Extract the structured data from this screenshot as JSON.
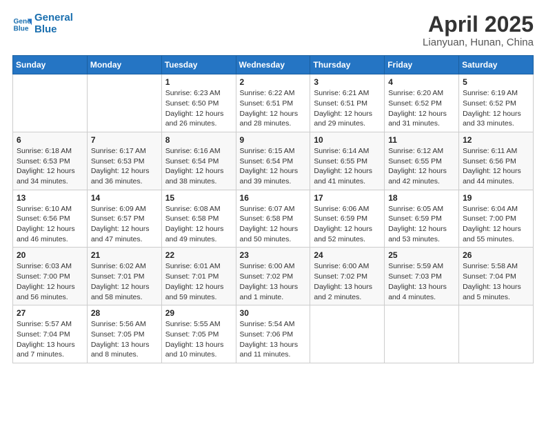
{
  "header": {
    "logo_line1": "General",
    "logo_line2": "Blue",
    "title": "April 2025",
    "subtitle": "Lianyuan, Hunan, China"
  },
  "calendar": {
    "days_of_week": [
      "Sunday",
      "Monday",
      "Tuesday",
      "Wednesday",
      "Thursday",
      "Friday",
      "Saturday"
    ],
    "weeks": [
      [
        {
          "day": "",
          "info": ""
        },
        {
          "day": "",
          "info": ""
        },
        {
          "day": "1",
          "info": "Sunrise: 6:23 AM\nSunset: 6:50 PM\nDaylight: 12 hours\nand 26 minutes."
        },
        {
          "day": "2",
          "info": "Sunrise: 6:22 AM\nSunset: 6:51 PM\nDaylight: 12 hours\nand 28 minutes."
        },
        {
          "day": "3",
          "info": "Sunrise: 6:21 AM\nSunset: 6:51 PM\nDaylight: 12 hours\nand 29 minutes."
        },
        {
          "day": "4",
          "info": "Sunrise: 6:20 AM\nSunset: 6:52 PM\nDaylight: 12 hours\nand 31 minutes."
        },
        {
          "day": "5",
          "info": "Sunrise: 6:19 AM\nSunset: 6:52 PM\nDaylight: 12 hours\nand 33 minutes."
        }
      ],
      [
        {
          "day": "6",
          "info": "Sunrise: 6:18 AM\nSunset: 6:53 PM\nDaylight: 12 hours\nand 34 minutes."
        },
        {
          "day": "7",
          "info": "Sunrise: 6:17 AM\nSunset: 6:53 PM\nDaylight: 12 hours\nand 36 minutes."
        },
        {
          "day": "8",
          "info": "Sunrise: 6:16 AM\nSunset: 6:54 PM\nDaylight: 12 hours\nand 38 minutes."
        },
        {
          "day": "9",
          "info": "Sunrise: 6:15 AM\nSunset: 6:54 PM\nDaylight: 12 hours\nand 39 minutes."
        },
        {
          "day": "10",
          "info": "Sunrise: 6:14 AM\nSunset: 6:55 PM\nDaylight: 12 hours\nand 41 minutes."
        },
        {
          "day": "11",
          "info": "Sunrise: 6:12 AM\nSunset: 6:55 PM\nDaylight: 12 hours\nand 42 minutes."
        },
        {
          "day": "12",
          "info": "Sunrise: 6:11 AM\nSunset: 6:56 PM\nDaylight: 12 hours\nand 44 minutes."
        }
      ],
      [
        {
          "day": "13",
          "info": "Sunrise: 6:10 AM\nSunset: 6:56 PM\nDaylight: 12 hours\nand 46 minutes."
        },
        {
          "day": "14",
          "info": "Sunrise: 6:09 AM\nSunset: 6:57 PM\nDaylight: 12 hours\nand 47 minutes."
        },
        {
          "day": "15",
          "info": "Sunrise: 6:08 AM\nSunset: 6:58 PM\nDaylight: 12 hours\nand 49 minutes."
        },
        {
          "day": "16",
          "info": "Sunrise: 6:07 AM\nSunset: 6:58 PM\nDaylight: 12 hours\nand 50 minutes."
        },
        {
          "day": "17",
          "info": "Sunrise: 6:06 AM\nSunset: 6:59 PM\nDaylight: 12 hours\nand 52 minutes."
        },
        {
          "day": "18",
          "info": "Sunrise: 6:05 AM\nSunset: 6:59 PM\nDaylight: 12 hours\nand 53 minutes."
        },
        {
          "day": "19",
          "info": "Sunrise: 6:04 AM\nSunset: 7:00 PM\nDaylight: 12 hours\nand 55 minutes."
        }
      ],
      [
        {
          "day": "20",
          "info": "Sunrise: 6:03 AM\nSunset: 7:00 PM\nDaylight: 12 hours\nand 56 minutes."
        },
        {
          "day": "21",
          "info": "Sunrise: 6:02 AM\nSunset: 7:01 PM\nDaylight: 12 hours\nand 58 minutes."
        },
        {
          "day": "22",
          "info": "Sunrise: 6:01 AM\nSunset: 7:01 PM\nDaylight: 12 hours\nand 59 minutes."
        },
        {
          "day": "23",
          "info": "Sunrise: 6:00 AM\nSunset: 7:02 PM\nDaylight: 13 hours\nand 1 minute."
        },
        {
          "day": "24",
          "info": "Sunrise: 6:00 AM\nSunset: 7:02 PM\nDaylight: 13 hours\nand 2 minutes."
        },
        {
          "day": "25",
          "info": "Sunrise: 5:59 AM\nSunset: 7:03 PM\nDaylight: 13 hours\nand 4 minutes."
        },
        {
          "day": "26",
          "info": "Sunrise: 5:58 AM\nSunset: 7:04 PM\nDaylight: 13 hours\nand 5 minutes."
        }
      ],
      [
        {
          "day": "27",
          "info": "Sunrise: 5:57 AM\nSunset: 7:04 PM\nDaylight: 13 hours\nand 7 minutes."
        },
        {
          "day": "28",
          "info": "Sunrise: 5:56 AM\nSunset: 7:05 PM\nDaylight: 13 hours\nand 8 minutes."
        },
        {
          "day": "29",
          "info": "Sunrise: 5:55 AM\nSunset: 7:05 PM\nDaylight: 13 hours\nand 10 minutes."
        },
        {
          "day": "30",
          "info": "Sunrise: 5:54 AM\nSunset: 7:06 PM\nDaylight: 13 hours\nand 11 minutes."
        },
        {
          "day": "",
          "info": ""
        },
        {
          "day": "",
          "info": ""
        },
        {
          "day": "",
          "info": ""
        }
      ]
    ]
  }
}
